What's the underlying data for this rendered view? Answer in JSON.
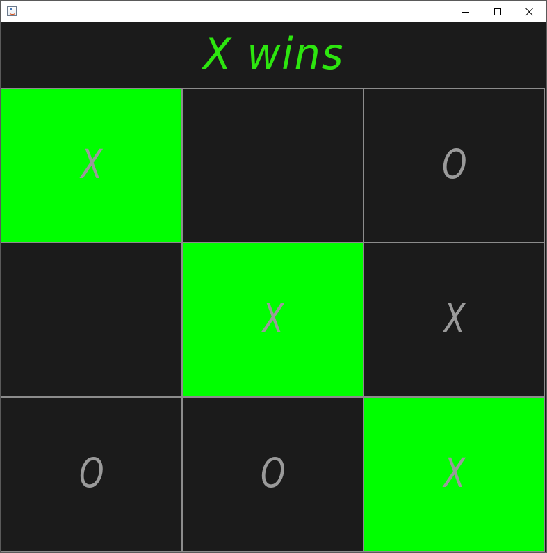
{
  "window": {
    "icon": "java-cup-icon",
    "controls": [
      "minimize-icon",
      "maximize-icon",
      "close-icon"
    ]
  },
  "status": "X wins",
  "colors": {
    "background": "#1b1b1b",
    "winning_cell": "#00ff00",
    "status_text": "#2de60f",
    "mark": "#9a9a9a",
    "grid_line": "#8c8c8c"
  },
  "board": {
    "cells": [
      {
        "mark": "X",
        "winning": true
      },
      {
        "mark": "",
        "winning": false
      },
      {
        "mark": "O",
        "winning": false
      },
      {
        "mark": "",
        "winning": false
      },
      {
        "mark": "X",
        "winning": true
      },
      {
        "mark": "X",
        "winning": false
      },
      {
        "mark": "O",
        "winning": false
      },
      {
        "mark": "O",
        "winning": false
      },
      {
        "mark": "X",
        "winning": true
      }
    ]
  }
}
